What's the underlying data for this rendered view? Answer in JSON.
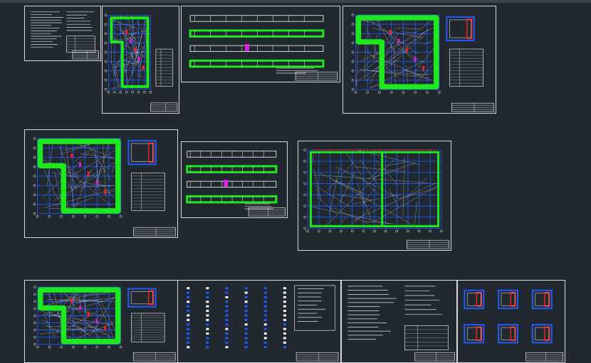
{
  "viewport": {
    "background": "#212830"
  },
  "colors": {
    "sheet_border": "#d8d8d8",
    "grid_line": "#1e5cff",
    "highlight": "#1ee81e",
    "accent_red": "#ff2020",
    "accent_magenta": "#e020e0",
    "ink": "#ffffff"
  },
  "sheets": [
    {
      "id": "s1",
      "kind": "notes"
    },
    {
      "id": "s2",
      "kind": "plan"
    },
    {
      "id": "s3",
      "kind": "section"
    },
    {
      "id": "s4",
      "kind": "plan"
    },
    {
      "id": "s5",
      "kind": "plan"
    },
    {
      "id": "s6",
      "kind": "section"
    },
    {
      "id": "s7",
      "kind": "grid"
    },
    {
      "id": "s8",
      "kind": "plan"
    },
    {
      "id": "s9",
      "kind": "schedule"
    },
    {
      "id": "s10",
      "kind": "notes"
    },
    {
      "id": "s11",
      "kind": "details"
    }
  ]
}
